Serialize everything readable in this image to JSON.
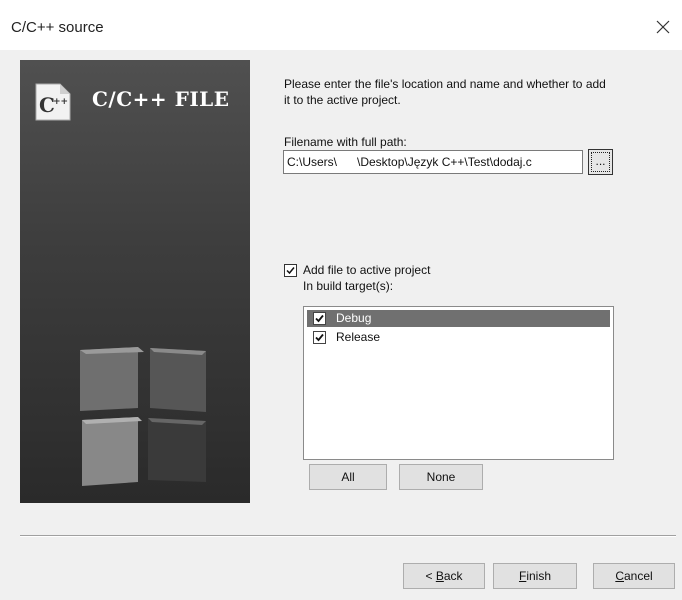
{
  "window": {
    "title": "C/C++ source"
  },
  "side_panel": {
    "banner": "C/C++ FILE",
    "icon": "cpp-file-icon"
  },
  "form": {
    "instructions": "Please enter the file's location and name and whether to add it to the active project.",
    "filename_label": "Filename with full path:",
    "filename_value": "C:\\Users\\      \\Desktop\\Język C++\\Test\\dodaj.c",
    "browse_label": "...",
    "add_to_project_label": "Add file to active project",
    "add_to_project_checked": true,
    "build_targets_label": "In build target(s):",
    "build_targets": [
      {
        "label": "Debug",
        "checked": true,
        "selected": true
      },
      {
        "label": "Release",
        "checked": true,
        "selected": false
      }
    ],
    "all_button": "All",
    "none_button": "None"
  },
  "footer": {
    "back_button": {
      "prefix": "< ",
      "mnemonic": "B",
      "rest": "ack"
    },
    "finish_button": {
      "mnemonic": "F",
      "rest": "inish"
    },
    "cancel_button": {
      "mnemonic": "C",
      "rest": "ancel"
    }
  }
}
